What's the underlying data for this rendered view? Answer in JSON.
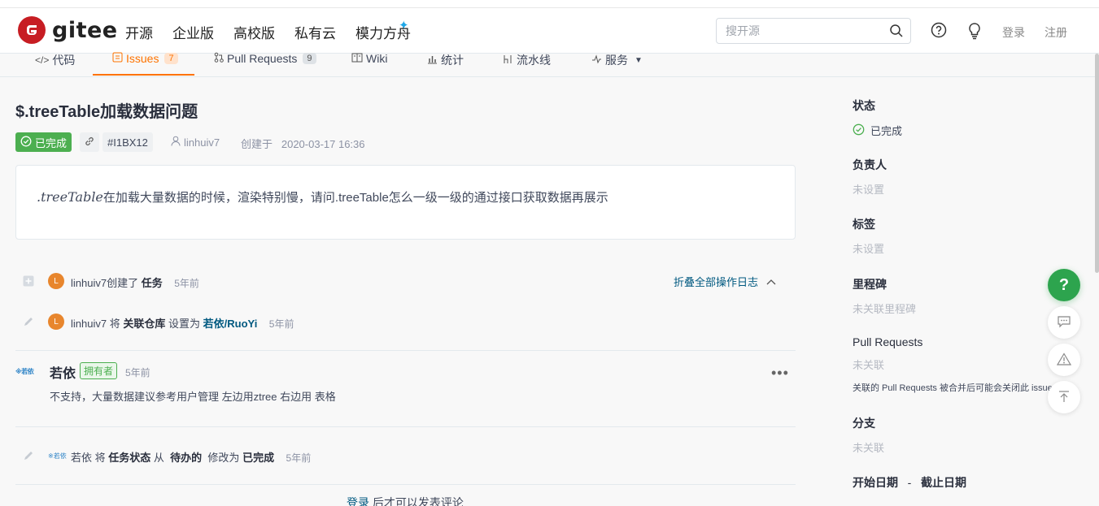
{
  "header": {
    "logo_text": "gitee",
    "nav": [
      "开源",
      "企业版",
      "高校版",
      "私有云",
      "模力方舟"
    ],
    "search_placeholder": "搜开源",
    "login": "登录",
    "register": "注册"
  },
  "tabs": [
    {
      "label": "代码",
      "icon": "code-icon"
    },
    {
      "label": "Issues",
      "count": "7",
      "icon": "issues-icon",
      "active": true
    },
    {
      "label": "Pull Requests",
      "count": "9",
      "icon": "pull-request-icon"
    },
    {
      "label": "Wiki",
      "icon": "wiki-icon"
    },
    {
      "label": "统计",
      "icon": "stats-icon"
    },
    {
      "label": "流水线",
      "icon": "pipeline-icon"
    },
    {
      "label": "服务",
      "icon": "service-icon"
    }
  ],
  "issue": {
    "title": "$.treeTable加载数据问题",
    "status": "已完成",
    "id": "#I1BX12",
    "author": "linhuiv7",
    "created_label": "创建于",
    "created_at": "2020-03-17 16:36",
    "body_prefix": ".treeTable",
    "body_rest": "在加载大量数据的时候，渲染特别慢，请问.treeTable怎么一级一级的通过接口获取数据再展示"
  },
  "timeline": {
    "create_user": "linhuiv7",
    "create_action": "创建了",
    "create_object": "任务",
    "create_time": "5年前",
    "fold_label": "折叠全部操作日志",
    "repo_user": "linhuiv7",
    "repo_will": "将",
    "repo_field": "关联仓库",
    "repo_set": "设置为",
    "repo_value": "若依/RuoYi",
    "repo_time": "5年前",
    "avatar_letter": "L"
  },
  "comment": {
    "avatar_text": "※若依",
    "name": "若依",
    "badge": "拥有者",
    "time": "5年前",
    "text": "不支持，大量数据建议参考用户管理 左边用ztree 右边用 表格"
  },
  "status_change": {
    "user": "若依",
    "will": "将",
    "field": "任务状态",
    "from_label": "从",
    "from": "待办的",
    "to_label": "修改为",
    "to": "已完成",
    "time": "5年前"
  },
  "bottom": {
    "login": "登录",
    "rest": "后才可以发表评论"
  },
  "sidebar": {
    "status_title": "状态",
    "status_value": "已完成",
    "assignee_title": "负责人",
    "assignee_value": "未设置",
    "labels_title": "标签",
    "labels_value": "未设置",
    "milestone_title": "里程碑",
    "milestone_value": "未关联里程碑",
    "pr_title": "Pull Requests",
    "pr_value": "未关联",
    "pr_note": "关联的 Pull Requests 被合并后可能会关闭此 issue",
    "branch_title": "分支",
    "branch_value": "未关联",
    "start_date": "开始日期",
    "date_sep": "-",
    "end_date": "截止日期"
  },
  "colors": {
    "brand_red": "#c71d23",
    "active_orange": "#fe7300",
    "success_green": "#4caf50",
    "link_blue": "#005980"
  }
}
